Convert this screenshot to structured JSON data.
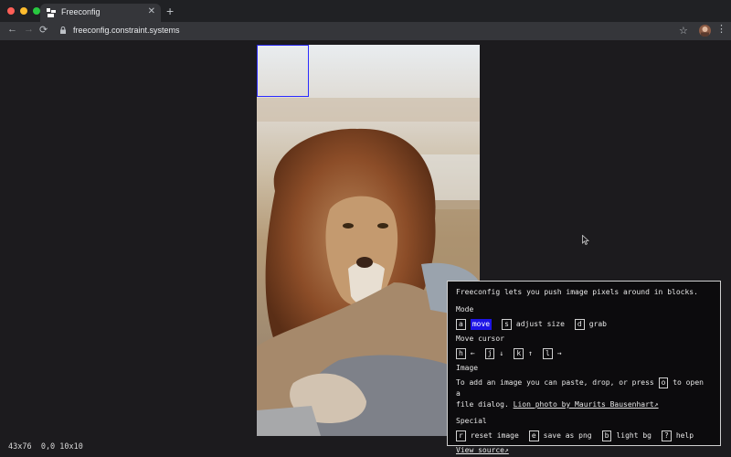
{
  "browser": {
    "tab_title": "Freeconfig",
    "tab_close": "✕",
    "new_tab": "+",
    "url": "freeconfig.constraint.systems",
    "back": "←",
    "forward": "→",
    "reload": "⟳",
    "star": "☆",
    "menu": "⋮",
    "traffic_colors": [
      "#ff5f57",
      "#febc2e",
      "#28c840"
    ]
  },
  "status_text": "43x76  0,0 10x10",
  "help": {
    "intro": "Freeconfig lets you push image pixels around in blocks.",
    "mode_heading": "Mode",
    "mode_items": [
      {
        "key": "a",
        "label": "move",
        "selected": true
      },
      {
        "key": "s",
        "label": "adjust size"
      },
      {
        "key": "d",
        "label": "grab"
      }
    ],
    "cursor_heading": "Move cursor",
    "cursor_keys": [
      {
        "key": "h",
        "label": "←"
      },
      {
        "key": "j",
        "label": "↓"
      },
      {
        "key": "k",
        "label": "↑"
      },
      {
        "key": "l",
        "label": "→"
      }
    ],
    "image_heading": "Image",
    "image_text_1": "To add an image you can paste, drop, or press",
    "image_key": "o",
    "image_text_2": "to open a",
    "image_text_3": "file dialog.",
    "image_credit": "Lion photo by Maurits Bausenhart↗",
    "special_heading": "Special",
    "special_items": [
      {
        "key": "r",
        "label": "reset image"
      },
      {
        "key": "e",
        "label": "save as png"
      },
      {
        "key": "b",
        "label": "light bg"
      },
      {
        "key": "?",
        "label": "help"
      }
    ],
    "source_link": "View source↗"
  },
  "colors": {
    "selection": "#1d14e6",
    "cursor_block": "#2b2bff",
    "background": "#1c1b1e"
  }
}
